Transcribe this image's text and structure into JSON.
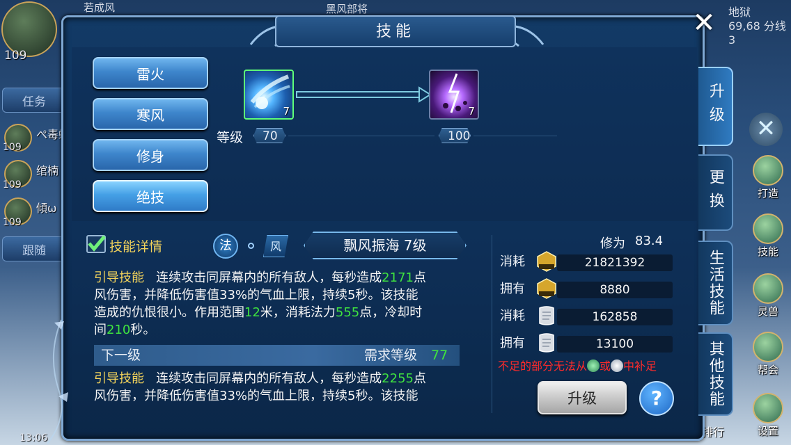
{
  "top": {
    "left_name": "若成风",
    "center_name": "黑风部将",
    "map_name": "地狱",
    "coords": "69,68 分线3"
  },
  "hud_left": {
    "player_level": "109",
    "task_label": "任务",
    "follow_label": "跟随",
    "time": "13:06",
    "party": [
      {
        "name": "ぺ毒蛛",
        "level": "109"
      },
      {
        "name": "绾楠",
        "level": "109"
      },
      {
        "name": "傾ω",
        "level": "109"
      }
    ]
  },
  "hud_right": {
    "items": [
      "打造",
      "技能",
      "灵兽",
      "帮会",
      "设置"
    ],
    "rank_label": "排行"
  },
  "dialog": {
    "title": "技能",
    "close_icon": "close-icon",
    "schools": [
      "雷火",
      "寒风",
      "修身",
      "绝技"
    ],
    "active_school": "绝技",
    "skill_current": {
      "icon": "wind-spiral-skill-icon",
      "count": "7"
    },
    "skill_next": {
      "icon": "lightning-skill-icon",
      "count": "7"
    },
    "level_label": "等级",
    "level_current": "70",
    "level_next": "100",
    "tabs": [
      "升级",
      "更换",
      "生活技能",
      "其他技能"
    ],
    "active_tab": "升级"
  },
  "details": {
    "checkbox_label": "技能详情",
    "type_tag1": "法",
    "type_tag2": "风",
    "skill_name": "飘风振海 7级",
    "current_desc": {
      "kind": "引导技能",
      "p1": "连续攻击同屏幕内的所有敌人，每秒造成",
      "dmg": "2171",
      "p2": "点",
      "p3": "风伤害，并降低伤害值33%的气血上限，持续5秒。该技能",
      "p4": "造成的仇恨很小。作用范围",
      "range": "12",
      "p5": "米，消耗法力",
      "mana": "555",
      "p6": "点，冷却时",
      "p7": "间",
      "cd": "210",
      "p8": "秒。"
    },
    "next_label": "下一级",
    "next_req_label": "需求等级",
    "next_req_value": "77",
    "next_desc": {
      "kind": "引导技能",
      "p1": "连续攻击同屏幕内的所有敌人，每秒造成",
      "dmg": "2255",
      "p2": "点",
      "p3": "风伤害，并降低伤害值33%的气血上限，持续5秒。该技能"
    }
  },
  "costs": {
    "xiuwei_label": "修为",
    "xiuwei_value": "83.4",
    "rows": [
      {
        "label": "消耗",
        "icon": "skill-exp-icon",
        "value": "21821392"
      },
      {
        "label": "拥有",
        "icon": "skill-exp-icon",
        "value": "8880"
      },
      {
        "label": "消耗",
        "icon": "scroll-icon",
        "value": "162858"
      },
      {
        "label": "拥有",
        "icon": "scroll-icon",
        "value": "13100"
      }
    ],
    "warning_a": "不足的部分无法从",
    "warning_b": "或",
    "warning_c": "中补足",
    "upgrade_label": "升级",
    "help_label": "?"
  },
  "colors": {
    "highlight": "#f3d35b",
    "number": "#3fe33f",
    "warning": "#ff2a2a"
  }
}
